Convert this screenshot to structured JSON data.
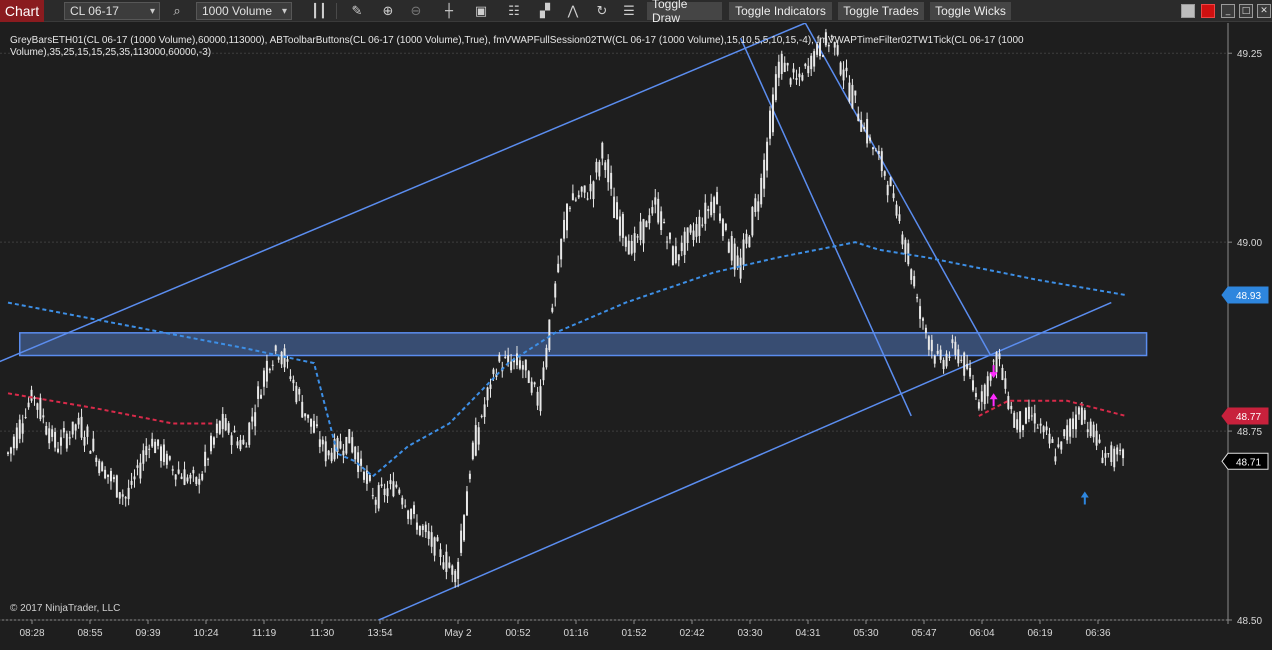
{
  "toolbar": {
    "tab_label": "Chart",
    "instrument": "CL 06-17",
    "period": "1000 Volume",
    "icons": [
      "search-icon",
      "bar-style-icon",
      "pencil-icon",
      "zoom-in-icon",
      "zoom-out-icon",
      "crosshair-icon",
      "data-box-icon",
      "properties-icon",
      "strategies-icon",
      "indicators-icon",
      "refresh-icon",
      "templates-icon"
    ],
    "toggle_draw": "Toggle Draw",
    "toggle_indicators": "Toggle Indicators",
    "toggle_trades": "Toggle Trades",
    "toggle_wicks": "Toggle Wicks"
  },
  "legend": "GreyBarsETH01(CL 06-17 (1000 Volume),60000,113000), ABToolbarButtons(CL 06-17 (1000 Volume),True), fmVWAPFullSession02TW(CL 06-17 (1000 Volume),15,10,5,5,10,15,-4), fmVWAPTimeFilter02TW1Tick(CL 06-17 (1000 Volume),35,25,15,15,25,35,113000,60000,-3)",
  "copyright": "© 2017 NinjaTrader, LLC",
  "colors": {
    "background": "#1e1e1e",
    "bar": "#e8e8e8",
    "trendline": "#5b8def",
    "vwap_full": "#3d8fe6",
    "vwap_filter": "#d92a4a",
    "zone_fill": "#4f74b8",
    "price_marker_blue": "#2e86de",
    "price_marker_red": "#c8213c",
    "arrow_magenta": "#ff2bff",
    "arrow_blue": "#2e86de"
  },
  "chart_data": {
    "type": "candlestick",
    "instrument": "CL 06-17",
    "ylim": [
      48.5,
      49.29
    ],
    "y_ticks": [
      "49.25",
      "49.00",
      "48.75",
      "48.50"
    ],
    "x_ticks": [
      "08:28",
      "08:55",
      "09:39",
      "10:24",
      "11:19",
      "11:30",
      "13:54",
      "May 2",
      "00:52",
      "01:16",
      "01:52",
      "02:42",
      "03:30",
      "04:31",
      "05:30",
      "05:47",
      "06:04",
      "06:19",
      "06:36"
    ],
    "price_markers": [
      {
        "label": "48.93",
        "value": 48.93,
        "style": "blue"
      },
      {
        "label": "48.77",
        "value": 48.77,
        "style": "red"
      },
      {
        "label": "48.71",
        "value": 48.71,
        "style": "current"
      }
    ],
    "close_path": [
      [
        0,
        48.72
      ],
      [
        8,
        48.8
      ],
      [
        16,
        48.73
      ],
      [
        24,
        48.76
      ],
      [
        32,
        48.7
      ],
      [
        40,
        48.66
      ],
      [
        48,
        48.74
      ],
      [
        56,
        48.7
      ],
      [
        64,
        48.68
      ],
      [
        72,
        48.76
      ],
      [
        80,
        48.73
      ],
      [
        88,
        48.84
      ],
      [
        92,
        48.86
      ],
      [
        100,
        48.78
      ],
      [
        108,
        48.72
      ],
      [
        116,
        48.74
      ],
      [
        124,
        48.66
      ],
      [
        132,
        48.68
      ],
      [
        138,
        48.63
      ],
      [
        146,
        48.59
      ],
      [
        152,
        48.56
      ],
      [
        158,
        48.73
      ],
      [
        166,
        48.84
      ],
      [
        174,
        48.84
      ],
      [
        180,
        48.79
      ],
      [
        190,
        49.05
      ],
      [
        198,
        49.07
      ],
      [
        202,
        49.12
      ],
      [
        206,
        49.04
      ],
      [
        212,
        48.99
      ],
      [
        220,
        49.05
      ],
      [
        226,
        48.98
      ],
      [
        234,
        49.02
      ],
      [
        240,
        49.06
      ],
      [
        248,
        48.96
      ],
      [
        256,
        49.08
      ],
      [
        262,
        49.24
      ],
      [
        268,
        49.21
      ],
      [
        274,
        49.25
      ],
      [
        280,
        49.27
      ],
      [
        286,
        49.2
      ],
      [
        292,
        49.14
      ],
      [
        298,
        49.09
      ],
      [
        304,
        49.01
      ],
      [
        310,
        48.9
      ],
      [
        316,
        48.84
      ],
      [
        322,
        48.86
      ],
      [
        330,
        48.79
      ],
      [
        336,
        48.85
      ],
      [
        342,
        48.76
      ],
      [
        348,
        48.77
      ],
      [
        356,
        48.72
      ],
      [
        364,
        48.78
      ],
      [
        372,
        48.72
      ],
      [
        380,
        48.71
      ]
    ],
    "vwap_full_session": [
      [
        0,
        48.92
      ],
      [
        80,
        48.86
      ],
      [
        104,
        48.84
      ],
      [
        112,
        48.72
      ],
      [
        118,
        48.71
      ],
      [
        124,
        48.69
      ],
      [
        136,
        48.73
      ],
      [
        150,
        48.76
      ],
      [
        170,
        48.84
      ],
      [
        186,
        48.88
      ],
      [
        210,
        48.92
      ],
      [
        240,
        48.96
      ],
      [
        262,
        48.98
      ],
      [
        288,
        49.0
      ],
      [
        296,
        48.99
      ],
      [
        312,
        48.98
      ],
      [
        350,
        48.95
      ],
      [
        380,
        48.93
      ]
    ],
    "vwap_time_filter": [
      [
        0,
        48.8
      ],
      [
        30,
        48.78
      ],
      [
        56,
        48.76
      ],
      [
        70,
        48.76
      ],
      [
        330,
        48.77
      ],
      [
        340,
        48.79
      ],
      [
        360,
        48.79
      ],
      [
        380,
        48.77
      ]
    ],
    "trend_lines": [
      {
        "p1": [
          -4,
          48.84
        ],
        "p2": [
          271,
          49.29
        ]
      },
      {
        "p1": [
          126,
          48.5
        ],
        "p2": [
          375,
          48.92
        ]
      },
      {
        "p1": [
          249,
          49.27
        ],
        "p2": [
          307,
          48.77
        ]
      },
      {
        "p1": [
          271,
          49.29
        ],
        "p2": [
          334,
          48.85
        ]
      }
    ],
    "zone": {
      "x_from": 4,
      "x_to": 387,
      "y_low": 48.85,
      "y_high": 48.88
    },
    "arrows": [
      {
        "x": 335,
        "value": 48.82,
        "direction": "down",
        "style": "magenta"
      },
      {
        "x": 335,
        "value": 48.8,
        "direction": "up",
        "style": "magenta"
      },
      {
        "x": 366,
        "value": 48.67,
        "direction": "up",
        "style": "blue"
      }
    ]
  }
}
